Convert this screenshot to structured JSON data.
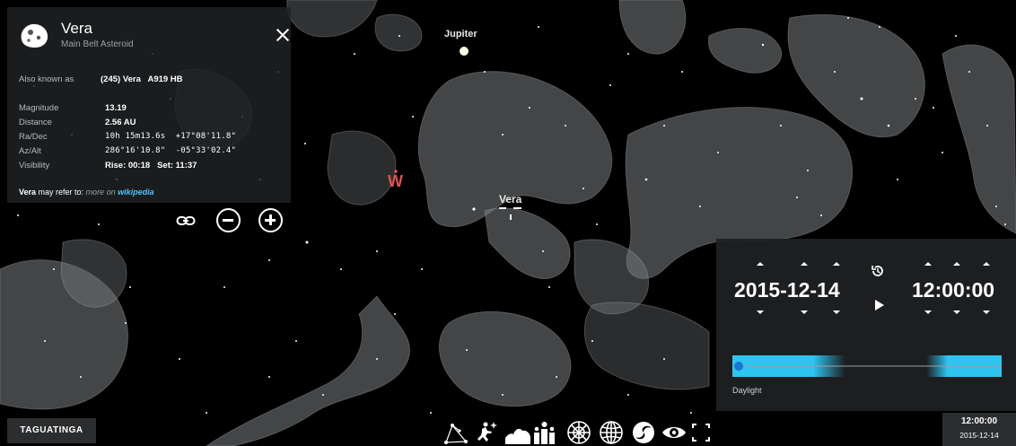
{
  "info_panel": {
    "name": "Vera",
    "type": "Main Belt Asteroid",
    "also_known_as_label": "Also known as",
    "also_known_as_value": "(245) Vera   A919 HB",
    "rows": [
      {
        "label": "Magnitude",
        "value": "13.19"
      },
      {
        "label": "Distance",
        "value": "2.56 AU"
      },
      {
        "label": "Ra/Dec",
        "value": "10h 15m13.6s  +17°08'11.8\""
      },
      {
        "label": "Az/Alt",
        "value": "286°16'10.8\"  -05°33'02.4\""
      },
      {
        "label": "Visibility",
        "value": "Rise: 00:18   Set: 11:37"
      }
    ],
    "refer_name": "Vera",
    "refer_text": " may refer to:",
    "refer_more": "more on",
    "refer_link": "wikipedia",
    "icon": "asteroid-icon"
  },
  "sky": {
    "labels": {
      "jupiter": "Jupiter",
      "vera": "Vera",
      "west": "W"
    },
    "colors": {
      "background": "#000000",
      "constellation_art": "#8c8c8c",
      "cardinal": "#e0524f"
    }
  },
  "time_panel": {
    "date": "2015-12-14",
    "time": "12:00:00",
    "daylight_label": "Daylight",
    "daylight_position": 0.5,
    "colors": {
      "daylight": "#2ec4f0"
    }
  },
  "location": {
    "label": "TAGUATINGA"
  },
  "clock": {
    "time": "12:00:00",
    "date": "2015-12-14"
  },
  "toolbar": {
    "buttons": [
      "constellation-lines-icon",
      "constellation-art-icon",
      "landscape-icon",
      "atmosphere-icon",
      "azimuthal-grid-icon",
      "equatorial-grid-icon",
      "nebulae-icon",
      "night-mode-icon",
      "fullscreen-icon"
    ]
  }
}
